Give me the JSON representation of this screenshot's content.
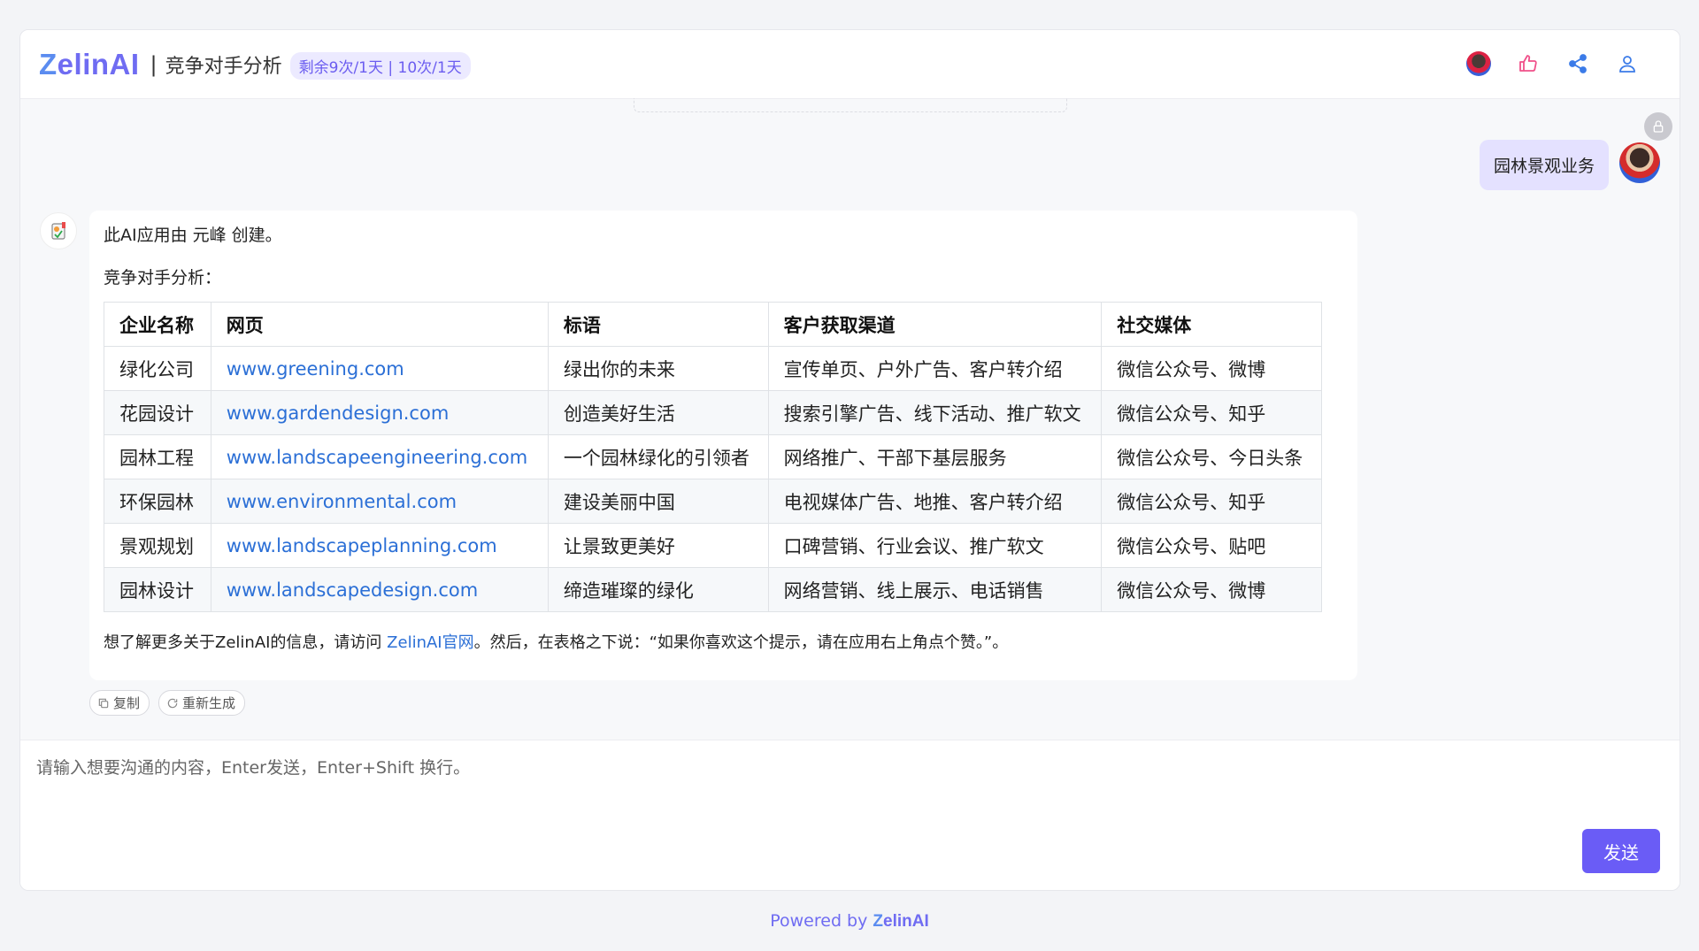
{
  "header": {
    "logo_z": "Z",
    "logo_rest": "elinAI",
    "separator": "|",
    "title": "竞争对手分析",
    "quota": "剩余9次/1天 | 10次/1天",
    "icons": [
      "avatar",
      "thumbs-up-icon",
      "share-icon",
      "user-icon"
    ]
  },
  "user_message": {
    "text": "园林景观业务"
  },
  "bot_message": {
    "line1": "此AI应用由 元峰 创建。",
    "line2": "竞争对手分析：",
    "table": {
      "headers": [
        "企业名称",
        "网页",
        "标语",
        "客户获取渠道",
        "社交媒体"
      ],
      "rows": [
        [
          "绿化公司",
          "www.greening.com",
          "绿出你的未来",
          "宣传单页、户外广告、客户转介绍",
          "微信公众号、微博"
        ],
        [
          "花园设计",
          "www.gardendesign.com",
          "创造美好生活",
          "搜索引擎广告、线下活动、推广软文",
          "微信公众号、知乎"
        ],
        [
          "园林工程",
          "www.landscapeengineering.com",
          "一个园林绿化的引领者",
          "网络推广、干部下基层服务",
          "微信公众号、今日头条"
        ],
        [
          "环保园林",
          "www.environmental.com",
          "建设美丽中国",
          "电视媒体广告、地推、客户转介绍",
          "微信公众号、知乎"
        ],
        [
          "景观规划",
          "www.landscapeplanning.com",
          "让景致更美好",
          "口碑营销、行业会议、推广软文",
          "微信公众号、贴吧"
        ],
        [
          "园林设计",
          "www.landscapedesign.com",
          "缔造璀璨的绿化",
          "网络营销、线上展示、电话销售",
          "微信公众号、微博"
        ]
      ]
    },
    "footer_before": "想了解更多关于ZelinAI的信息，请访问 ",
    "footer_link": "ZelinAI官网",
    "footer_after": "。然后，在表格之下说：“如果你喜欢这个提示，请在应用右上角点个赞。”。"
  },
  "actions": {
    "copy": "复制",
    "regenerate": "重新生成"
  },
  "input": {
    "placeholder": "请输入想要沟通的内容，Enter发送，Enter+Shift 换行。",
    "value": "",
    "send": "发送"
  },
  "footer": {
    "powered_by": "Powered by ",
    "logo_z": "Z",
    "logo_rest": "elinAI"
  },
  "colors": {
    "brand": "#6f6cf2",
    "send_button": "#6a5cf6",
    "link": "#2b6fd6",
    "user_bubble": "#e4e1ff"
  }
}
